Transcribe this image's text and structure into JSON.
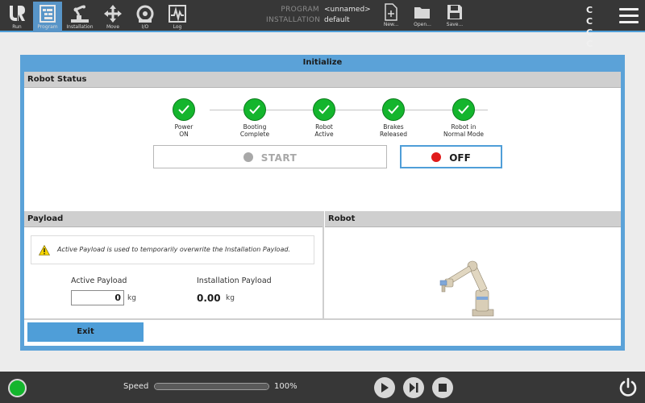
{
  "topbar": {
    "nav": [
      {
        "label": "Run",
        "icon": "ur-logo-icon"
      },
      {
        "label": "Program",
        "icon": "program-icon",
        "active": true
      },
      {
        "label": "Installation",
        "icon": "installation-icon"
      },
      {
        "label": "Move",
        "icon": "move-icon"
      },
      {
        "label": "I/O",
        "icon": "io-icon"
      },
      {
        "label": "Log",
        "icon": "log-icon"
      }
    ],
    "program_key": "PROGRAM",
    "program_value": "<unnamed>",
    "installation_key": "INSTALLATION",
    "installation_value": "default",
    "file_buttons": [
      {
        "label": "New...",
        "icon": "new-file-icon"
      },
      {
        "label": "Open...",
        "icon": "open-folder-icon"
      },
      {
        "label": "Save...",
        "icon": "save-icon"
      }
    ],
    "cc_indicator": "C C C C"
  },
  "dialog": {
    "title": "Initialize",
    "robot_status": {
      "heading": "Robot Status",
      "steps": [
        {
          "line1": "Power",
          "line2": "ON",
          "state": "done"
        },
        {
          "line1": "Booting",
          "line2": "Complete",
          "state": "done"
        },
        {
          "line1": "Robot",
          "line2": "Active",
          "state": "done"
        },
        {
          "line1": "Brakes",
          "line2": "Released",
          "state": "done"
        },
        {
          "line1": "Robot in",
          "line2": "Normal Mode",
          "state": "done"
        }
      ],
      "start_label": "START",
      "off_label": "OFF"
    },
    "payload": {
      "heading": "Payload",
      "info": "Active Payload is used to temporarily overwrite the Installation Payload.",
      "active_label": "Active Payload",
      "active_value": "0",
      "active_unit": "kg",
      "installation_label": "Installation Payload",
      "installation_value": "0.00",
      "installation_unit": "kg"
    },
    "robot": {
      "heading": "Robot"
    },
    "exit_label": "Exit"
  },
  "bottombar": {
    "speed_label": "Speed",
    "speed_value": "100%",
    "speed_fraction": 1.0
  },
  "colors": {
    "accent": "#4f9ed8",
    "ok_green": "#14b52d",
    "off_red": "#e01a1a",
    "bar_dark": "#373737"
  }
}
